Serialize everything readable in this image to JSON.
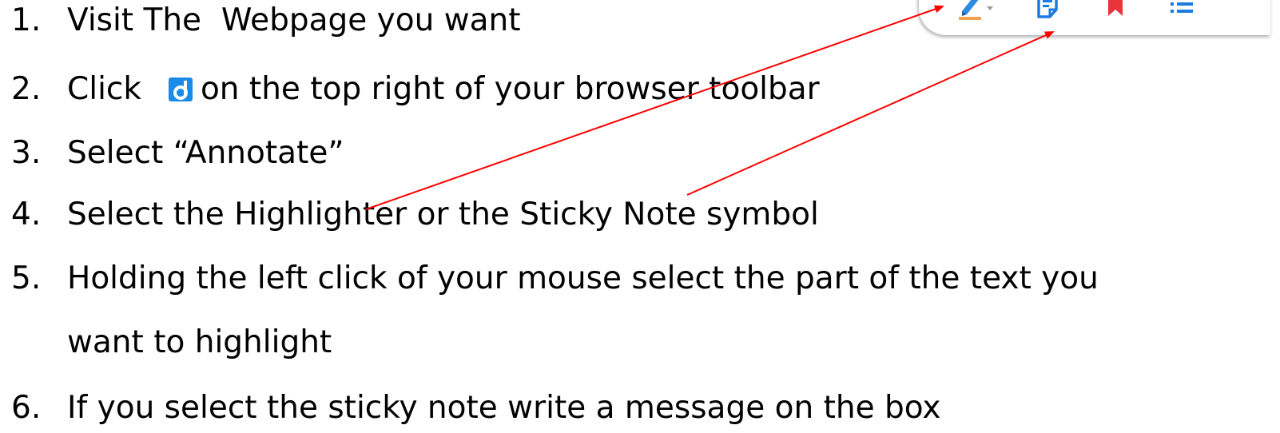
{
  "steps": [
    {
      "number": "1.",
      "text": "Visit The  Webpage you want"
    },
    {
      "number": "2.",
      "text_before_icon": "Click",
      "text_after_icon": "on the top right of your browser toolbar"
    },
    {
      "number": "3.",
      "text": "Select “Annotate”"
    },
    {
      "number": "4.",
      "text": "Select the Highlighter or the Sticky Note symbol"
    },
    {
      "number": "5.",
      "text": "Holding the left click of your mouse select the part of the text you",
      "continuation": "want to highlight"
    },
    {
      "number": "6.",
      "text": "If you select the sticky note write a message on the box"
    }
  ],
  "toolbar": {
    "icons": [
      "highlighter-icon",
      "dropdown-caret-icon",
      "sticky-note-icon",
      "bookmark-icon",
      "list-icon"
    ]
  },
  "inline_icon": "diigo-icon",
  "colors": {
    "arrow": "#ff0000",
    "diigo_blue": "#1a8be6",
    "highlighter_blue": "#2d8ae0",
    "highlighter_orange": "#f2a24e",
    "sticky_blue": "#1c7be0",
    "bookmark_red": "#e8343a",
    "list_blue": "#1c7be0"
  }
}
